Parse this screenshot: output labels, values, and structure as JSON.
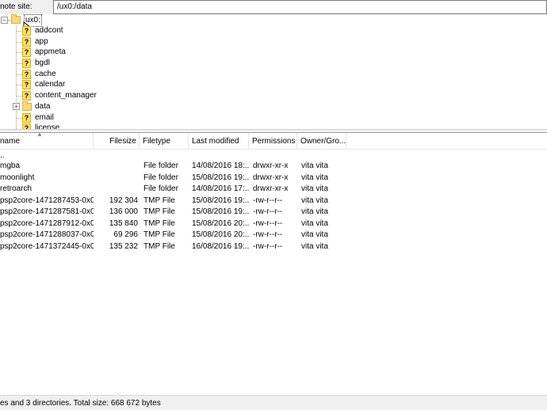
{
  "site_bar": {
    "label": "note site:",
    "path": "/ux0:/data"
  },
  "tree": {
    "root": "ux0:",
    "items": [
      {
        "label": "addcont",
        "icon": "question-icon"
      },
      {
        "label": "app",
        "icon": "question-icon"
      },
      {
        "label": "appmeta",
        "icon": "question-icon"
      },
      {
        "label": "bgdl",
        "icon": "question-icon"
      },
      {
        "label": "cache",
        "icon": "question-icon"
      },
      {
        "label": "calendar",
        "icon": "question-icon"
      },
      {
        "label": "content_manager",
        "icon": "question-icon"
      },
      {
        "label": "data",
        "icon": "folder-icon"
      },
      {
        "label": "email",
        "icon": "question-icon"
      },
      {
        "label": "license",
        "icon": "question-icon"
      }
    ],
    "expander_plus": "+",
    "expander_minus": "−"
  },
  "list": {
    "columns": {
      "name": "name",
      "size": "Filesize",
      "type": "Filetype",
      "modified": "Last modified",
      "perms": "Permissions",
      "owner": "Owner/Gro..."
    },
    "rows": [
      {
        "name": "..",
        "size": "",
        "type": "",
        "modified": "",
        "perms": "",
        "owner": ""
      },
      {
        "name": "mgba",
        "size": "",
        "type": "File folder",
        "modified": "14/08/2016 18:...",
        "perms": "drwxr-xr-x",
        "owner": "vita vita"
      },
      {
        "name": "moonlight",
        "size": "",
        "type": "File folder",
        "modified": "15/08/2016 19:...",
        "perms": "drwxr-xr-x",
        "owner": "vita vita"
      },
      {
        "name": "retroarch",
        "size": "",
        "type": "File folder",
        "modified": "14/08/2016 17:...",
        "perms": "drwxr-xr-x",
        "owner": "vita vita"
      },
      {
        "name": "psp2core-1471287453-0x000...",
        "size": "192 304",
        "type": "TMP File",
        "modified": "15/08/2016 19:...",
        "perms": "-rw-r--r--",
        "owner": "vita vita"
      },
      {
        "name": "psp2core-1471287581-0x000...",
        "size": "136 000",
        "type": "TMP File",
        "modified": "15/08/2016 19:...",
        "perms": "-rw-r--r--",
        "owner": "vita vita"
      },
      {
        "name": "psp2core-1471287912-0x000...",
        "size": "135 840",
        "type": "TMP File",
        "modified": "15/08/2016 20:...",
        "perms": "-rw-r--r--",
        "owner": "vita vita"
      },
      {
        "name": "psp2core-1471288037-0x000...",
        "size": "69 296",
        "type": "TMP File",
        "modified": "15/08/2016 20:...",
        "perms": "-rw-r--r--",
        "owner": "vita vita"
      },
      {
        "name": "psp2core-1471372445-0x000...",
        "size": "135 232",
        "type": "TMP File",
        "modified": "16/08/2016 19:...",
        "perms": "-rw-r--r--",
        "owner": "vita vita"
      }
    ]
  },
  "status": {
    "text": "es and 3 directories. Total size: 668 672 bytes"
  }
}
